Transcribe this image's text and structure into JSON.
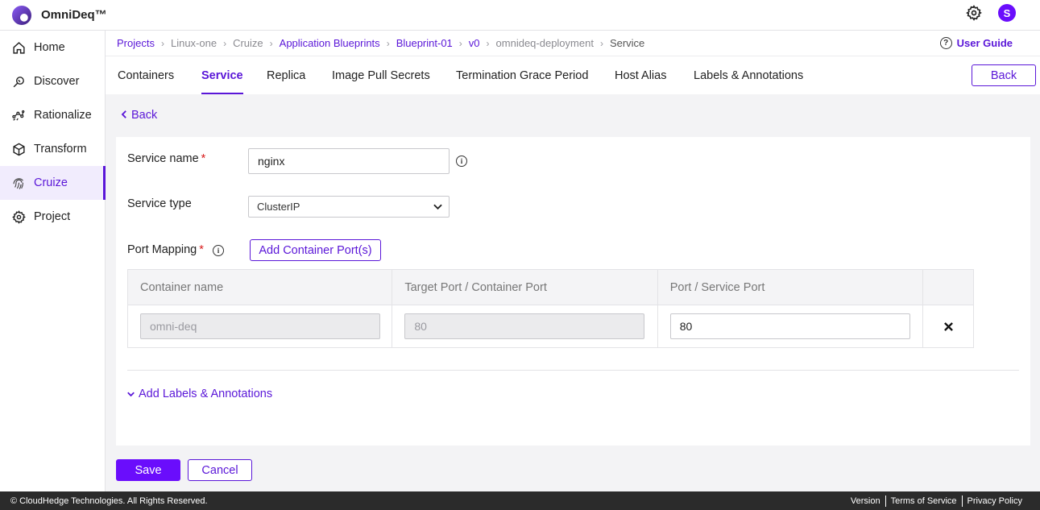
{
  "app": {
    "brand": "OmniDeq™",
    "user_initial": "S"
  },
  "sidebar": {
    "items": [
      {
        "label": "Home",
        "icon": "home-icon"
      },
      {
        "label": "Discover",
        "icon": "discover-icon"
      },
      {
        "label": "Rationalize",
        "icon": "rationalize-icon"
      },
      {
        "label": "Transform",
        "icon": "cube-icon"
      },
      {
        "label": "Cruize",
        "icon": "fingerprint-icon",
        "active": true
      },
      {
        "label": "Project",
        "icon": "gear-icon"
      }
    ]
  },
  "breadcrumb": {
    "items": [
      "Projects",
      "Linux-one",
      "Cruize",
      "Application Blueprints",
      "Blueprint-01",
      "v0",
      "omnideq-deployment",
      "Service"
    ],
    "user_guide": "User Guide"
  },
  "tabs": {
    "items": [
      "Containers",
      "Service",
      "Replica",
      "Image Pull Secrets",
      "Termination Grace Period",
      "Host Alias",
      "Labels & Annotations"
    ],
    "active": "Service",
    "back_label": "Back"
  },
  "form": {
    "back_link": "Back",
    "service_name_label": "Service name",
    "service_name_value": "nginx",
    "service_type_label": "Service type",
    "service_type_value": "ClusterIP",
    "port_mapping_label": "Port Mapping",
    "add_port_label": "Add Container Port(s)",
    "table": {
      "headers": [
        "Container name",
        "Target Port / Container Port",
        "Port / Service Port"
      ],
      "rows": [
        {
          "container_name": "omni-deq",
          "target_port": "80",
          "service_port": "80"
        }
      ]
    },
    "add_labels_label": "Add Labels & Annotations",
    "required_marker": "*",
    "info_glyph": "i"
  },
  "actions": {
    "save_label": "Save",
    "cancel_label": "Cancel"
  },
  "footer": {
    "copyright": "© CloudHedge Technologies. All Rights Reserved.",
    "links": [
      "Version",
      "Terms of Service",
      "Privacy Policy"
    ]
  },
  "colors": {
    "accent": "#5a16d8",
    "primary_button": "#6a0dfc",
    "required": "#d81b1b",
    "footer_bg": "#2b2b2b"
  }
}
